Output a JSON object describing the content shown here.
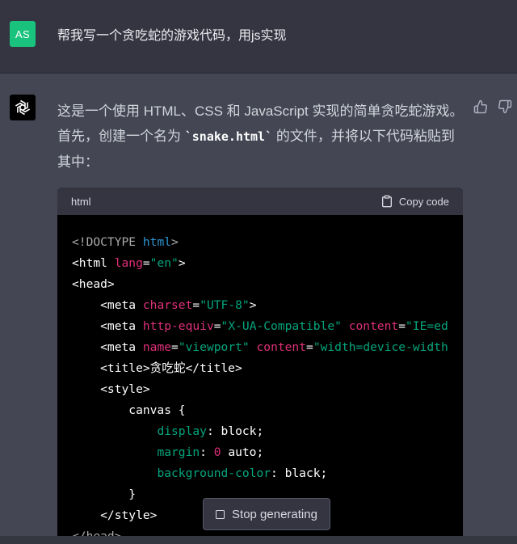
{
  "user_message": {
    "avatar_initials": "AS",
    "text": "帮我写一个贪吃蛇的游戏代码，用js实现"
  },
  "assistant_message": {
    "intro_part1": "这是一个使用 HTML、CSS 和 JavaScript 实现的简单贪吃蛇游戏。首先，创建一个名为 ",
    "filename_code": "`snake.html`",
    "intro_part2": " 的文件，并将以下代码粘贴到其中："
  },
  "code_block": {
    "language": "html",
    "copy_label": "Copy code",
    "lines": [
      [
        {
          "t": "<!DOCTYPE ",
          "c": "doc"
        },
        {
          "t": "html",
          "c": "kw"
        },
        {
          "t": ">",
          "c": "doc"
        }
      ],
      [
        {
          "t": "<html ",
          "c": "tag"
        },
        {
          "t": "lang",
          "c": "attr"
        },
        {
          "t": "=",
          "c": "punc"
        },
        {
          "t": "\"en\"",
          "c": "str"
        },
        {
          "t": ">",
          "c": "tag"
        }
      ],
      [
        {
          "t": "<head>",
          "c": "tag"
        }
      ],
      [
        {
          "t": "    <meta ",
          "c": "tag"
        },
        {
          "t": "charset",
          "c": "attr"
        },
        {
          "t": "=",
          "c": "punc"
        },
        {
          "t": "\"UTF-8\"",
          "c": "str"
        },
        {
          "t": ">",
          "c": "tag"
        }
      ],
      [
        {
          "t": "    <meta ",
          "c": "tag"
        },
        {
          "t": "http-equiv",
          "c": "attr"
        },
        {
          "t": "=",
          "c": "punc"
        },
        {
          "t": "\"X-UA-Compatible\"",
          "c": "str"
        },
        {
          "t": " ",
          "c": "punc"
        },
        {
          "t": "content",
          "c": "attr"
        },
        {
          "t": "=",
          "c": "punc"
        },
        {
          "t": "\"IE=ed",
          "c": "str"
        }
      ],
      [
        {
          "t": "    <meta ",
          "c": "tag"
        },
        {
          "t": "name",
          "c": "attr"
        },
        {
          "t": "=",
          "c": "punc"
        },
        {
          "t": "\"viewport\"",
          "c": "str"
        },
        {
          "t": " ",
          "c": "punc"
        },
        {
          "t": "content",
          "c": "attr"
        },
        {
          "t": "=",
          "c": "punc"
        },
        {
          "t": "\"width=device-width",
          "c": "str"
        }
      ],
      [
        {
          "t": "    <title>",
          "c": "tag"
        },
        {
          "t": "贪吃蛇",
          "c": "punc"
        },
        {
          "t": "</title>",
          "c": "tag"
        }
      ],
      [
        {
          "t": "    <style>",
          "c": "tag"
        }
      ],
      [
        {
          "t": "        canvas {",
          "c": "punc"
        }
      ],
      [
        {
          "t": "            ",
          "c": "punc"
        },
        {
          "t": "display",
          "c": "prop"
        },
        {
          "t": ": block;",
          "c": "punc"
        }
      ],
      [
        {
          "t": "            ",
          "c": "punc"
        },
        {
          "t": "margin",
          "c": "prop"
        },
        {
          "t": ": ",
          "c": "punc"
        },
        {
          "t": "0",
          "c": "num"
        },
        {
          "t": " auto;",
          "c": "punc"
        }
      ],
      [
        {
          "t": "            ",
          "c": "punc"
        },
        {
          "t": "background-color",
          "c": "prop"
        },
        {
          "t": ": black;",
          "c": "punc"
        }
      ],
      [
        {
          "t": "        }",
          "c": "punc"
        }
      ],
      [
        {
          "t": "    </style>",
          "c": "tag"
        }
      ],
      [
        {
          "t": "</head>",
          "c": "doc"
        }
      ]
    ]
  },
  "stop_button": {
    "label": "Stop generating"
  },
  "colors": {
    "background": "#444654",
    "user_row": "#343541",
    "user_avatar": "#19c37d",
    "code_bg": "#000000",
    "tag": "#ffffff",
    "attr": "#df3079",
    "string": "#00a67d",
    "keyword": "#2e95d3"
  }
}
